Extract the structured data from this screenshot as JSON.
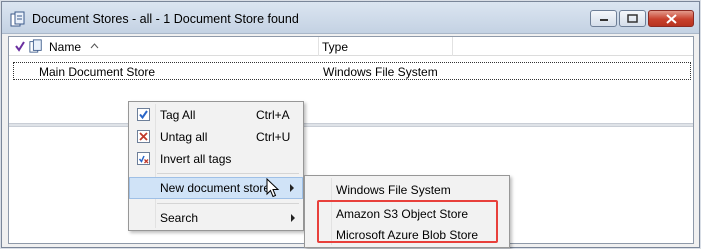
{
  "window": {
    "title": "Document Stores - all - 1 Document Store found"
  },
  "columns": [
    {
      "label": "Name"
    },
    {
      "label": "Type"
    }
  ],
  "rows": [
    {
      "name": "Main Document Store",
      "type": "Windows File System"
    }
  ],
  "context_menu": {
    "items": [
      {
        "label": "Tag All",
        "shortcut": "Ctrl+A",
        "icon": "check-tag-icon"
      },
      {
        "label": "Untag all",
        "shortcut": "Ctrl+U",
        "icon": "untag-icon"
      },
      {
        "label": "Invert all tags",
        "shortcut": "",
        "icon": "invert-tags-icon"
      },
      {
        "label": "New document store",
        "shortcut": "",
        "icon": ""
      },
      {
        "label": "Search",
        "shortcut": "",
        "icon": ""
      }
    ]
  },
  "submenu": {
    "items": [
      {
        "label": "Windows File System"
      },
      {
        "label": "Amazon S3 Object Store"
      },
      {
        "label": "Microsoft Azure Blob Store"
      }
    ]
  },
  "colors": {
    "highlight": "#d0e3f7",
    "annotation_box": "#e8403b",
    "close_button": "#c8402c"
  }
}
